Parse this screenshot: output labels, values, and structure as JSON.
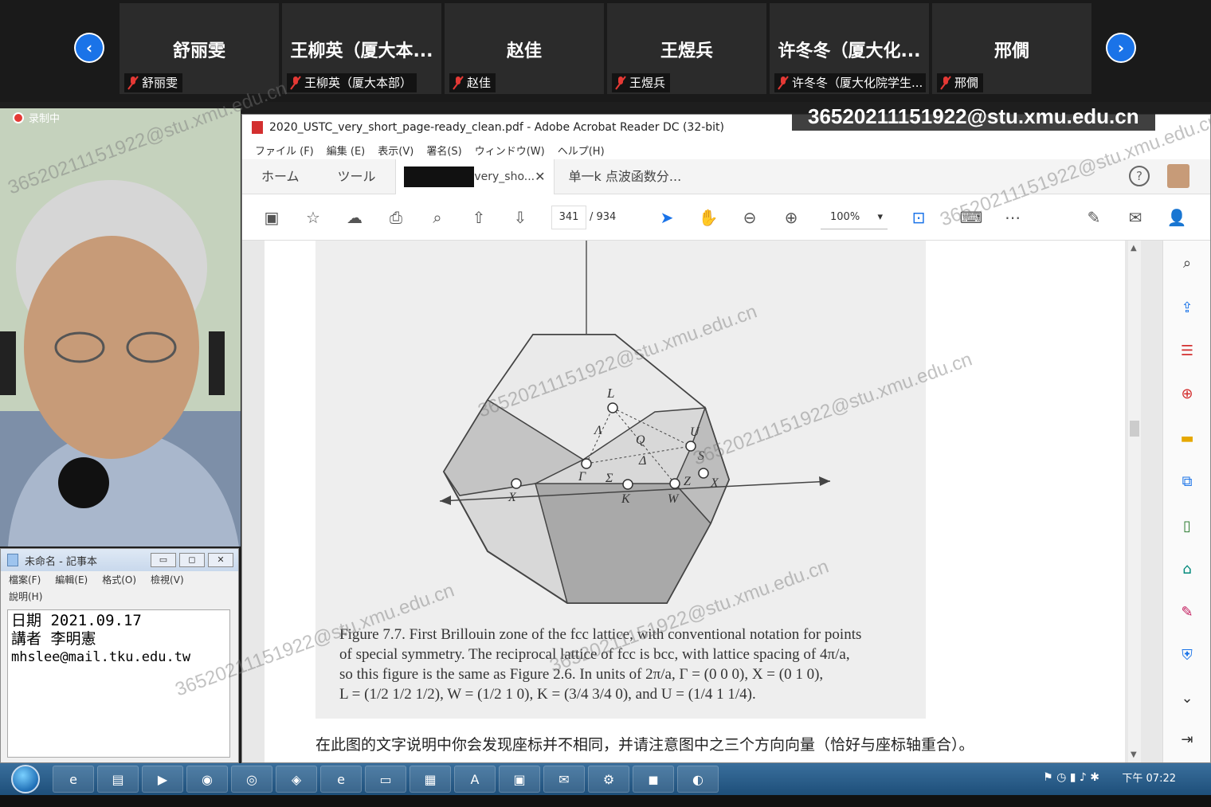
{
  "participants": [
    {
      "display": "舒丽雯",
      "label": "舒丽雯"
    },
    {
      "display": "王柳英（厦大本...",
      "label": "王柳英（厦大本部）"
    },
    {
      "display": "赵佳",
      "label": "赵佳"
    },
    {
      "display": "王煜兵",
      "label": "王煜兵"
    },
    {
      "display": "许冬冬（厦大化...",
      "label": "许冬冬（厦大化院学生..."
    },
    {
      "display": "邢僩",
      "label": "邢僩"
    }
  ],
  "recording_label": "录制中",
  "email_overlay": "36520211151922@stu.xmu.edu.cn",
  "watermark": "36520211151922@stu.xmu.edu.cn",
  "notepad": {
    "title": "未命名 - 記事本",
    "menu": [
      "檔案(F)",
      "編輯(E)",
      "格式(O)",
      "檢視(V)",
      "說明(H)"
    ],
    "lines": [
      "日期 2021.09.17",
      "講者 李明憲",
      "mhslee@mail.tku.edu.tw"
    ]
  },
  "acrobat": {
    "title": "2020_USTC_very_short_page-ready_clean.pdf - Adobe Acrobat Reader DC (32-bit)",
    "menu": [
      "ファイル (F)",
      "編集 (E)",
      "表示(V)",
      "署名(S)",
      "ウィンドウ(W)",
      "ヘルプ(H)"
    ],
    "tabs": {
      "home": "ホーム",
      "tools": "ツール",
      "doc1": "very_sho...",
      "doc2": "单一k 点波函数分..."
    },
    "page_current": "341",
    "page_total": "/ 934",
    "zoom": "100%"
  },
  "figure": {
    "labels": {
      "L": "L",
      "Lambda": "Λ",
      "Q": "Q",
      "U": "U",
      "Delta": "Δ",
      "S": "S",
      "Gamma": "Γ",
      "Sigma": "Σ",
      "K": "K",
      "W": "W",
      "Z": "Z",
      "X1": "X",
      "X2": "X"
    },
    "caption_lines": [
      "Figure 7.7. First Brillouin zone of the fcc lattice, with conventional notation for points",
      "of special symmetry.  The reciprocal lattice of fcc is bcc, with lattice spacing of 4π/a,",
      "so this figure is the same as Figure 2.6.  In units of 2π/a, Γ = (0 0 0), X = (0 1 0),",
      "L = (1/2 1/2 1/2), W = (1/2 1 0), K = (3/4 3/4 0), and U = (1/4 1 1/4)."
    ],
    "note": "在此图的文字说明中你会发现座标并不相同，并请注意图中之三个方向向量（恰好与座标轴重合）。"
  },
  "taskbar": {
    "clock": "下午 07:22"
  }
}
